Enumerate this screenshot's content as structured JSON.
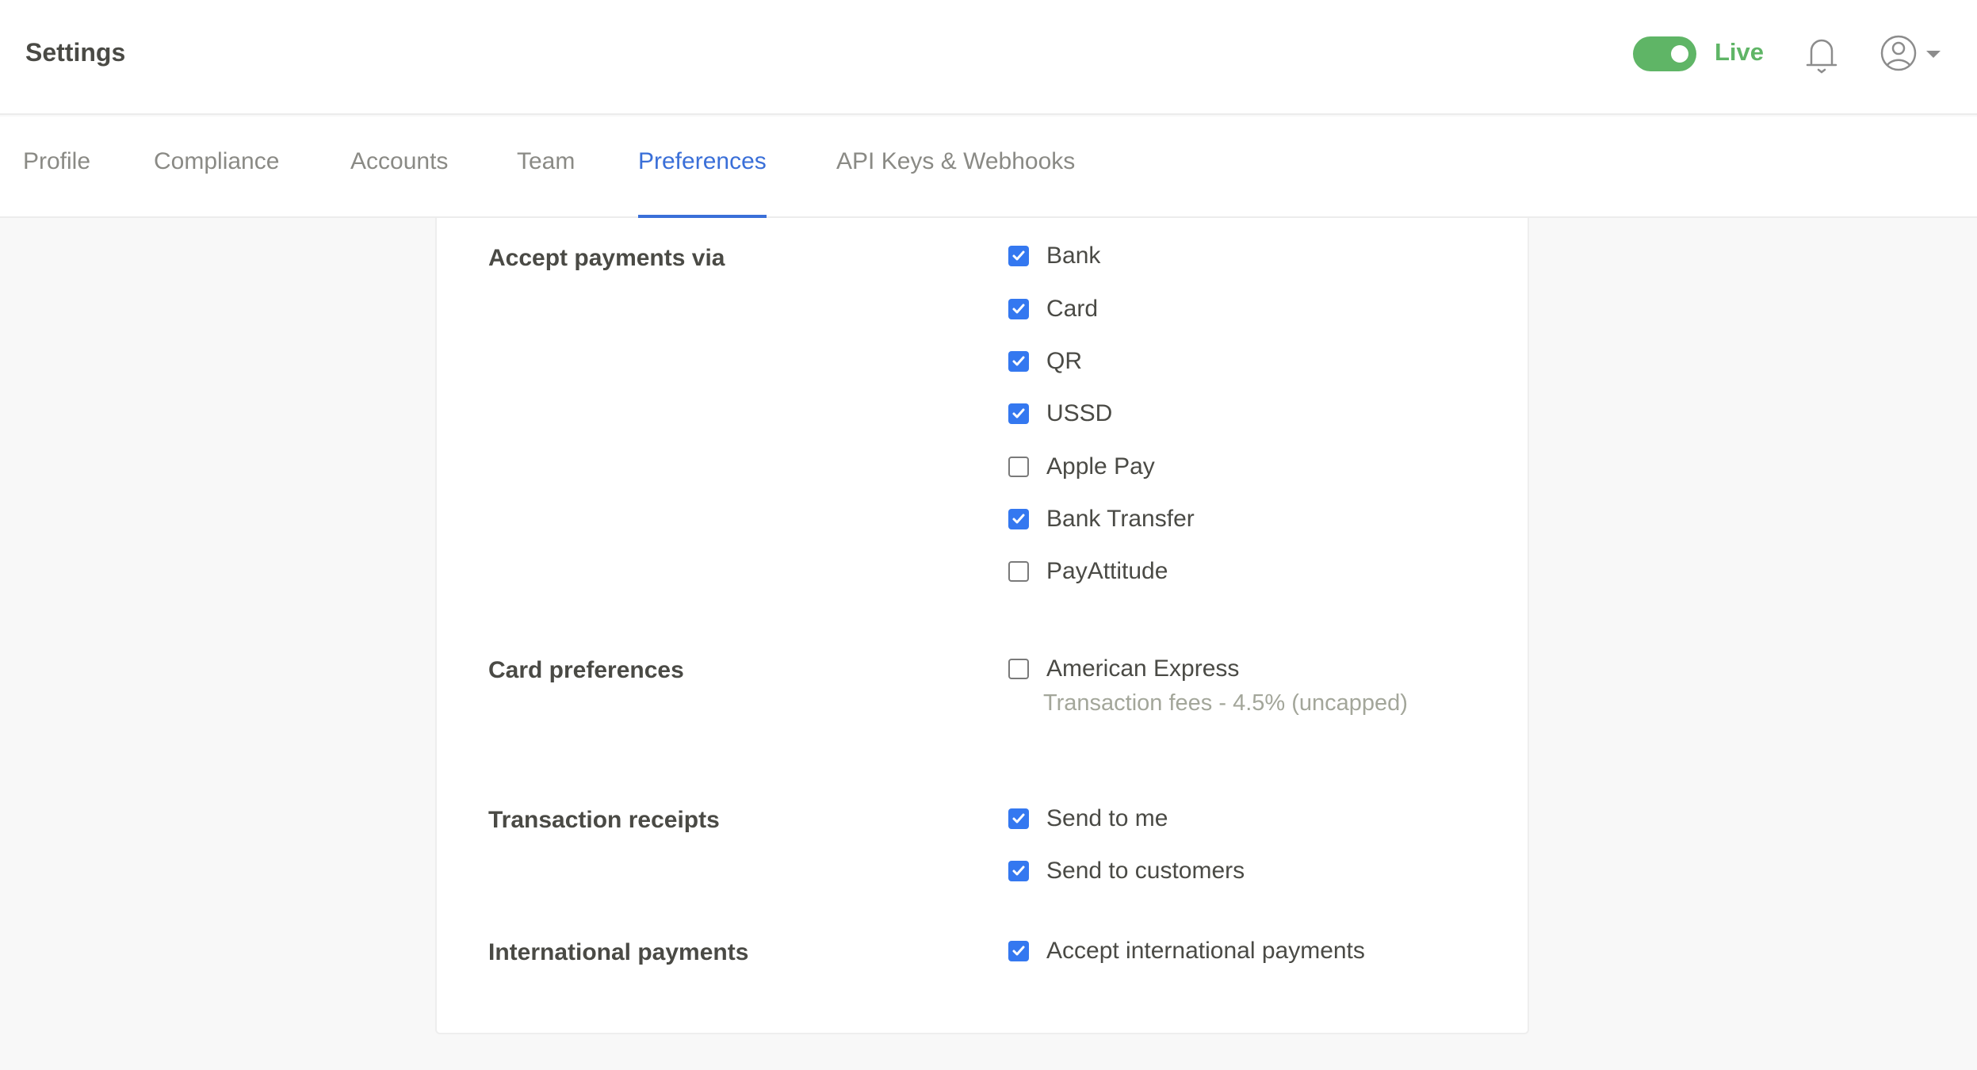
{
  "header": {
    "title": "Settings",
    "live_label": "Live",
    "live_on": true,
    "accent": "#5fb566"
  },
  "tabs": [
    {
      "label": "Profile",
      "active": false
    },
    {
      "label": "Compliance",
      "active": false
    },
    {
      "label": "Accounts",
      "active": false
    },
    {
      "label": "Team",
      "active": false
    },
    {
      "label": "Preferences",
      "active": true
    },
    {
      "label": "API Keys & Webhooks",
      "active": false
    }
  ],
  "sections": {
    "payments": {
      "label": "Accept payments via",
      "options": [
        {
          "label": "Bank",
          "checked": true
        },
        {
          "label": "Card",
          "checked": true
        },
        {
          "label": "QR",
          "checked": true
        },
        {
          "label": "USSD",
          "checked": true
        },
        {
          "label": "Apple Pay",
          "checked": false
        },
        {
          "label": "Bank Transfer",
          "checked": true
        },
        {
          "label": "PayAttitude",
          "checked": false
        }
      ]
    },
    "card": {
      "label": "Card preferences",
      "options": [
        {
          "label": "American Express",
          "checked": false
        }
      ],
      "fees": "Transaction fees - 4.5% (uncapped)"
    },
    "receipts": {
      "label": "Transaction receipts",
      "options": [
        {
          "label": "Send to me",
          "checked": true
        },
        {
          "label": "Send to customers",
          "checked": true
        }
      ]
    },
    "international": {
      "label": "International payments",
      "options": [
        {
          "label": "Accept international payments",
          "checked": true
        }
      ]
    }
  }
}
